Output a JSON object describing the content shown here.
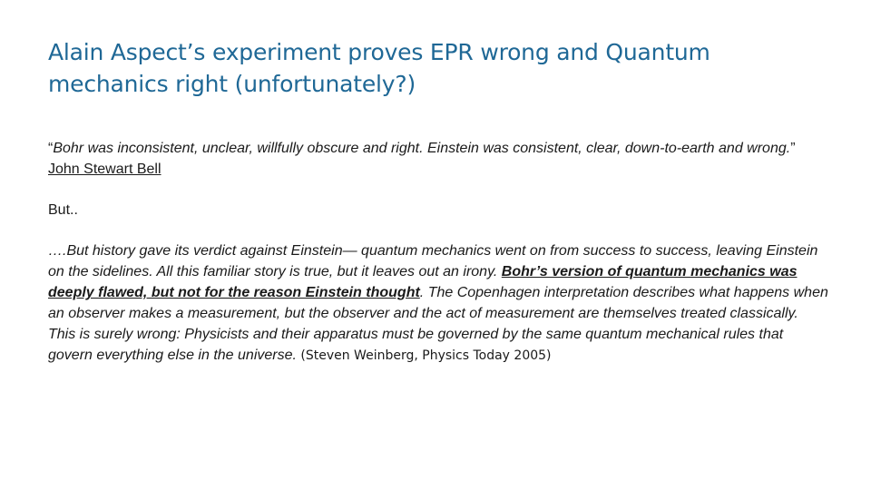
{
  "slide": {
    "title": "Alain Aspect’s experiment proves EPR wrong and Quantum mechanics right (unfortunately?)",
    "bell_quote": {
      "open_mark": "“",
      "text": "Bohr was inconsistent, unclear, willfully obscure and right. Einstein was consistent, clear, down-to-earth and wrong.",
      "close_mark": "”",
      "author_link": "John Stewart Bell"
    },
    "but_line": "But..",
    "weinberg": {
      "lead": "….But history gave its verdict against Einstein— quantum mechanics went on from success to success, leaving Einstein on the sidelines. All this familiar story is true, but it leaves out an irony. ",
      "emphasis": "Bohr’s version of quantum mechanics was deeply flawed, but not for the reason Einstein thought",
      "rest": ". The Copenhagen interpretation describes what happens when an observer makes a measurement, but the observer and the act of measurement are themselves treated classically. This is surely wrong: Physicists and their apparatus must be governed by the same quantum mechanical rules that govern everything else in the universe.",
      "citation": " (Steven Weinberg, Physics Today 2005)"
    }
  }
}
